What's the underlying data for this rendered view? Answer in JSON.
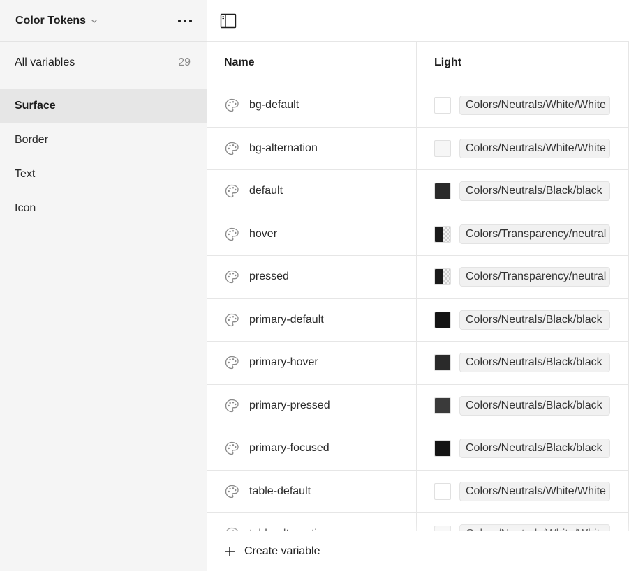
{
  "sidebar": {
    "collection_name": "Color Tokens",
    "all_variables": {
      "label": "All variables",
      "count": "29"
    },
    "groups": [
      {
        "label": "Surface",
        "active": true
      },
      {
        "label": "Border",
        "active": false
      },
      {
        "label": "Text",
        "active": false
      },
      {
        "label": "Icon",
        "active": false
      }
    ]
  },
  "table": {
    "columns": {
      "name": "Name",
      "light": "Light"
    },
    "rows": [
      {
        "name": "bg-default",
        "alias": "Colors/Neutrals/White/White",
        "swatch": "#ffffff",
        "transparent": false
      },
      {
        "name": "bg-alternation",
        "alias": "Colors/Neutrals/White/White",
        "swatch": "#f6f6f6",
        "transparent": false
      },
      {
        "name": "default",
        "alias": "Colors/Neutrals/Black/black",
        "swatch": "#2a2a2a",
        "transparent": false
      },
      {
        "name": "hover",
        "alias": "Colors/Transparency/neutral",
        "swatch": "#1a1a1a",
        "transparent": true
      },
      {
        "name": "pressed",
        "alias": "Colors/Transparency/neutral",
        "swatch": "#1a1a1a",
        "transparent": true
      },
      {
        "name": "primary-default",
        "alias": "Colors/Neutrals/Black/black",
        "swatch": "#141414",
        "transparent": false
      },
      {
        "name": "primary-hover",
        "alias": "Colors/Neutrals/Black/black",
        "swatch": "#2a2a2a",
        "transparent": false
      },
      {
        "name": "primary-pressed",
        "alias": "Colors/Neutrals/Black/black",
        "swatch": "#3a3a3a",
        "transparent": false
      },
      {
        "name": "primary-focused",
        "alias": "Colors/Neutrals/Black/black",
        "swatch": "#141414",
        "transparent": false
      },
      {
        "name": "table-default",
        "alias": "Colors/Neutrals/White/White",
        "swatch": "#ffffff",
        "transparent": false
      },
      {
        "name": "table-alternation",
        "alias": "Colors/Neutrals/White/White",
        "swatch": "#f6f6f6",
        "transparent": false
      }
    ]
  },
  "footer": {
    "create_label": "Create variable"
  },
  "icons": {
    "menu": "more-horizontal-icon",
    "panel": "sidebar-toggle-icon",
    "variable": "palette-icon",
    "add": "plus-icon"
  }
}
